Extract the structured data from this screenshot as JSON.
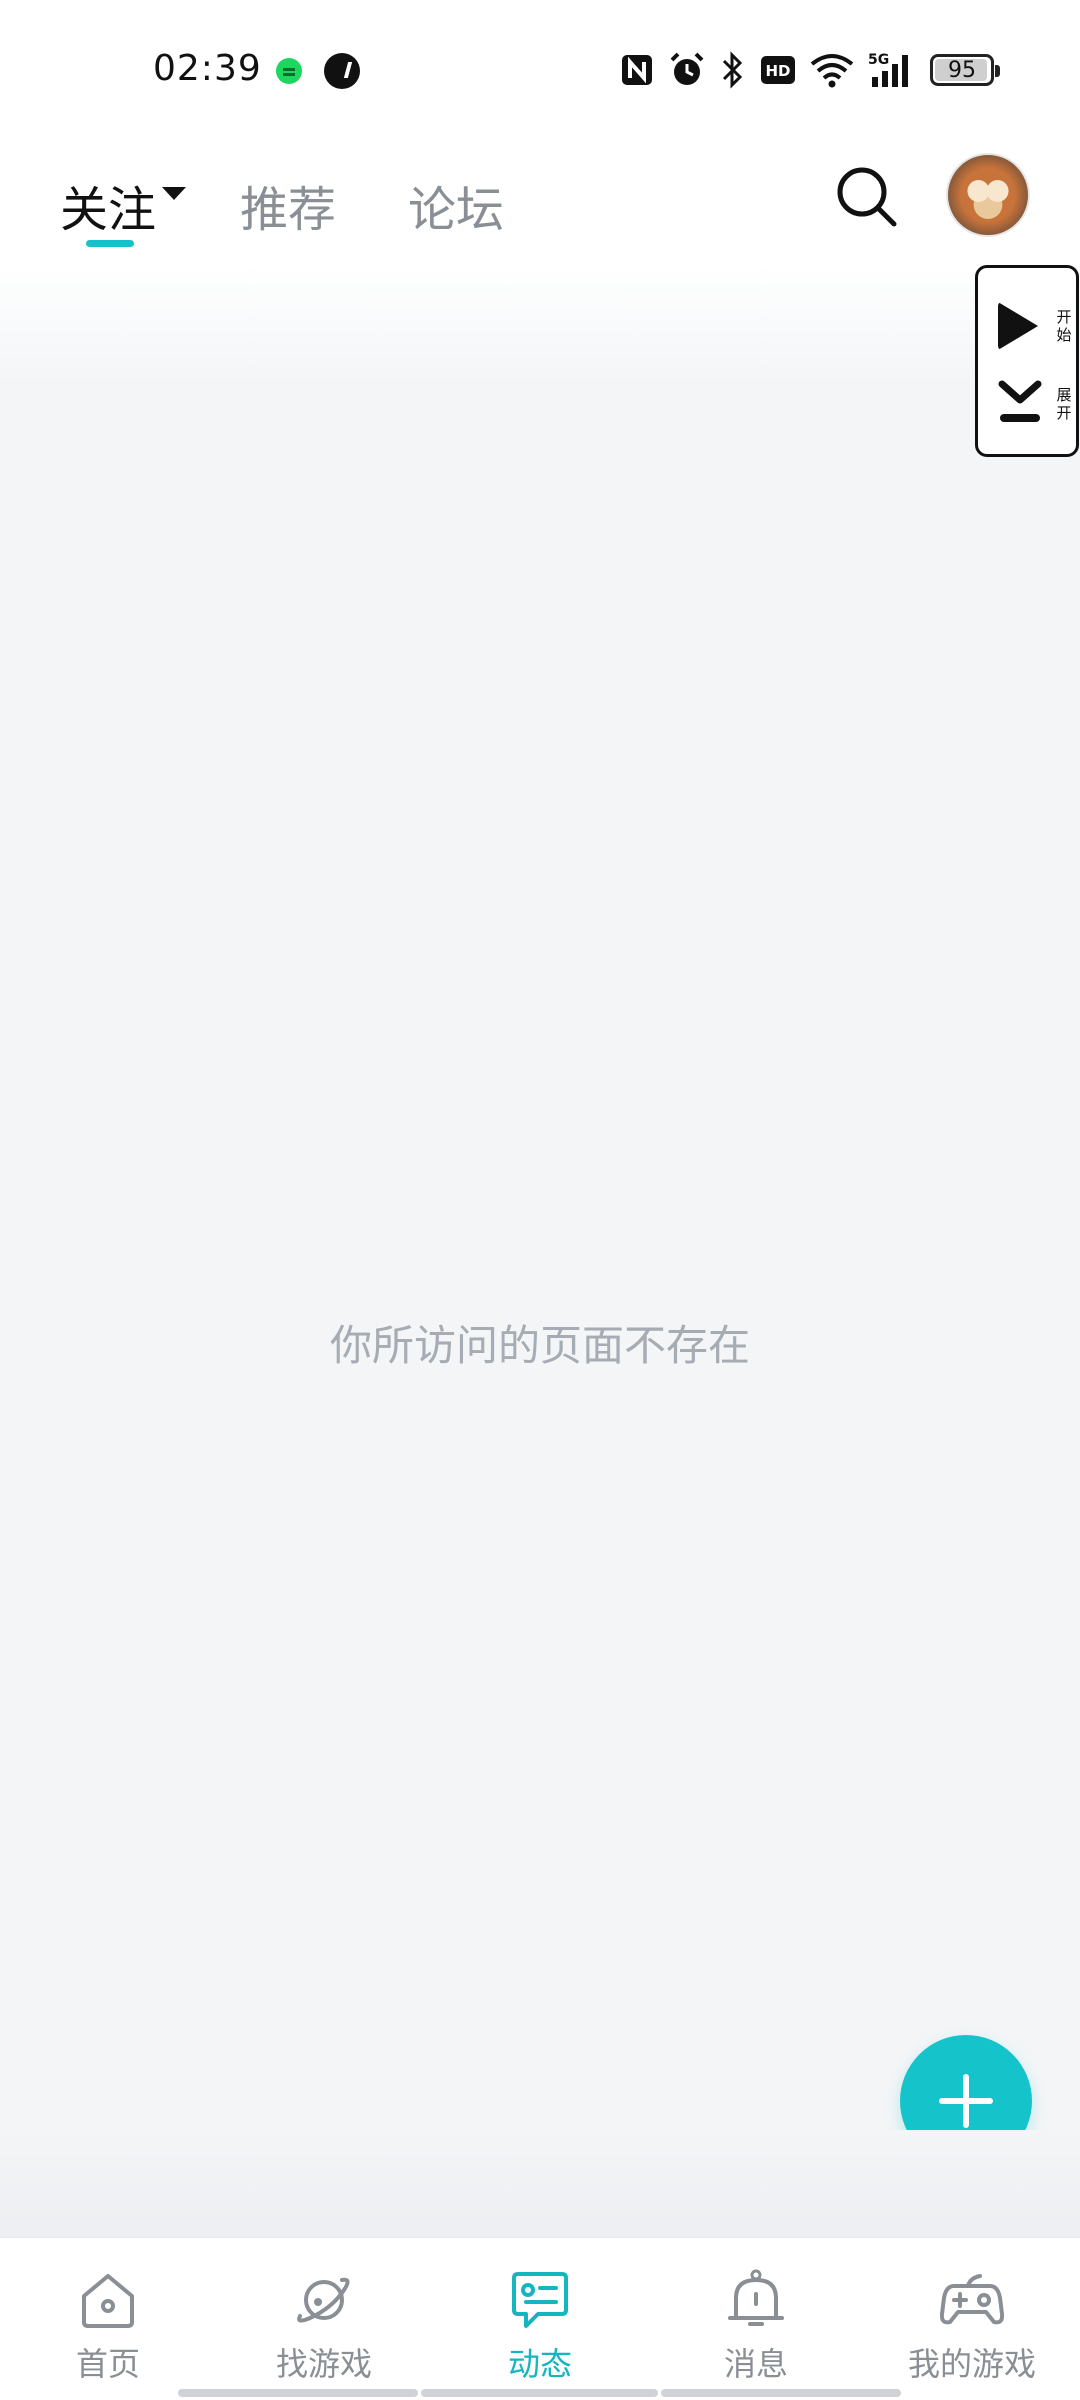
{
  "status_bar": {
    "time": "02:39",
    "battery_level": "95",
    "icons": [
      "spotify-icon",
      "app-icon",
      "nfc-icon",
      "alarm-icon",
      "bluetooth-icon",
      "hd-icon",
      "wifi-icon",
      "5g-signal-icon",
      "battery-icon"
    ]
  },
  "top_nav": {
    "tabs": [
      {
        "label": "关注",
        "active": true
      },
      {
        "label": "推荐",
        "active": false
      },
      {
        "label": "论坛",
        "active": false
      }
    ],
    "accent_color": "#16c2c9"
  },
  "side_widget": {
    "play_label": "开始",
    "collapse_label": "展开"
  },
  "main": {
    "empty_message": "你所访问的页面不存在"
  },
  "fab": {
    "icon": "plus-icon",
    "color": "#15c3cb"
  },
  "bottom_nav": {
    "items": [
      {
        "label": "首页",
        "icon": "home-icon",
        "active": false
      },
      {
        "label": "找游戏",
        "icon": "planet-icon",
        "active": false
      },
      {
        "label": "动态",
        "icon": "chat-card-icon",
        "active": true
      },
      {
        "label": "消息",
        "icon": "bell-icon",
        "active": false
      },
      {
        "label": "我的游戏",
        "icon": "gamepad-icon",
        "active": false
      }
    ]
  }
}
